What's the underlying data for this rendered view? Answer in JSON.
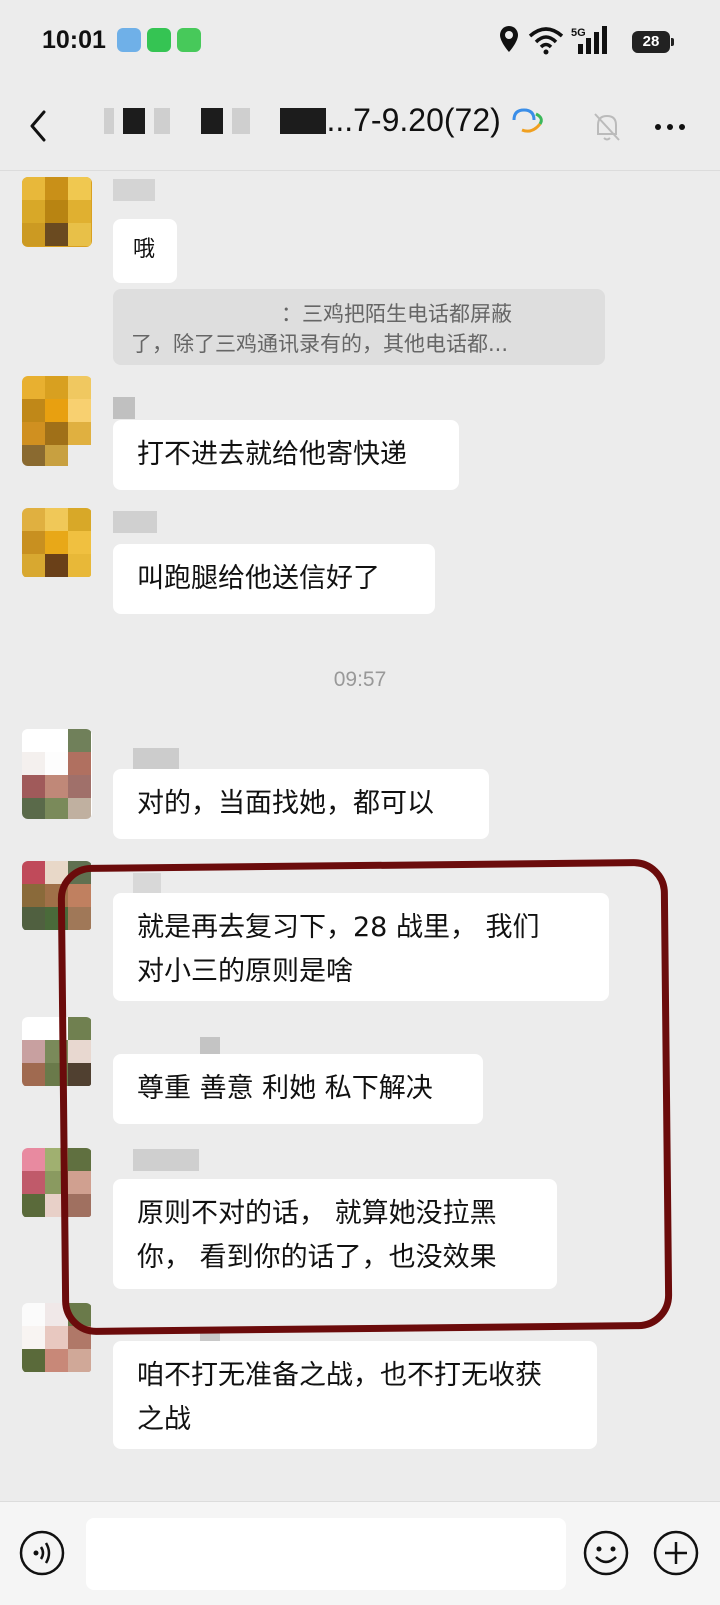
{
  "status_bar": {
    "time": "10:01",
    "network": "5G",
    "battery": "28"
  },
  "header": {
    "title_visible": "...7-9.20(72)"
  },
  "messages": [
    {
      "text": "哦"
    },
    {
      "quote_line1": "：三鸡把陌生电话都屏蔽",
      "quote_line2": "了，除了三鸡通讯录有的，其他电话都..."
    },
    {
      "text": "打不进去就给他寄快递"
    },
    {
      "text": "叫跑腿给他送信好了"
    },
    {
      "timestamp": "09:57"
    },
    {
      "text": "对的，当面找她，都可以"
    },
    {
      "line1": "就是再去复习下，28 战里， 我们",
      "line2": "对小三的原则是啥"
    },
    {
      "text": "尊重 善意 利她 私下解决"
    },
    {
      "line1": "原则不对的话， 就算她没拉黑",
      "line2": "你， 看到你的话了，也没效果"
    },
    {
      "line1": "咱不打无准备之战，也不打无收获",
      "line2": "之战"
    }
  ],
  "colors": {
    "background": "#ececec",
    "bubble": "#ffffff",
    "highlight": "#6b0b0b"
  }
}
